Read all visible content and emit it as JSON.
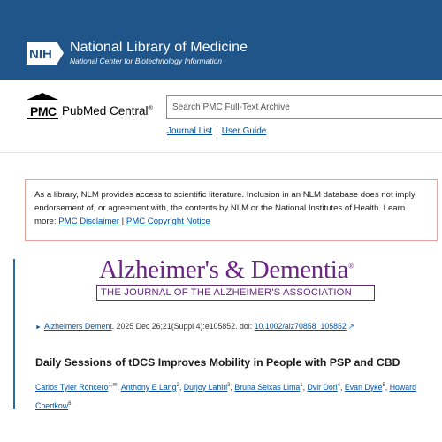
{
  "header": {
    "org_logo": "NIH",
    "org_name": "National Library of Medicine",
    "org_subtitle": "National Center for Biotechnology Information"
  },
  "pmc": {
    "logo_text": "PMC",
    "name": "PubMed Central",
    "trademark": "®"
  },
  "search": {
    "placeholder": "Search PMC Full-Text Archive"
  },
  "links": {
    "journal_list": "Journal List",
    "separator": "|",
    "user_guide": "User Guide"
  },
  "disclaimer": {
    "text": "As a library, NLM provides access to scientific literature. Inclusion in an NLM database does not imply endorsement of, or agreement with, the contents by NLM or the National Institutes of Health.",
    "learn_more": "Learn more:",
    "link1": "PMC Disclaimer",
    "separator": "|",
    "link2": "PMC Copyright Notice"
  },
  "journal": {
    "name": "Alzheimer's & Dementia",
    "trademark": "®",
    "subtitle": "THE JOURNAL OF THE ALZHEIMER'S ASSOCIATION"
  },
  "citation": {
    "journal": "Alzheimers Dement",
    "details": ". 2025 Dec 26;21(Suppl 4):e105852. doi: ",
    "doi": "10.1002/alz70858_105852"
  },
  "article": {
    "title": "Daily Sessions of tDCS Improves Mobility in People with PSP and CBD"
  },
  "authors": [
    {
      "name": "Carlos Tyler Roncero",
      "sup": "1,✉"
    },
    {
      "name": "Anthony E Lang",
      "sup": "2"
    },
    {
      "name": "Durjoy Lahiri",
      "sup": "3"
    },
    {
      "name": "Bruna Seixas Lima",
      "sup": "1"
    },
    {
      "name": "Dvir Dori",
      "sup": "4"
    },
    {
      "name": "Evan Dyke",
      "sup": "5"
    },
    {
      "name": "Howard Chertkow",
      "sup": "6"
    }
  ],
  "colors": {
    "nih_blue": "#20558a",
    "link_blue": "#0050a0",
    "journal_purple": "#6b2585",
    "disclaimer_border": "#e8a29b"
  }
}
